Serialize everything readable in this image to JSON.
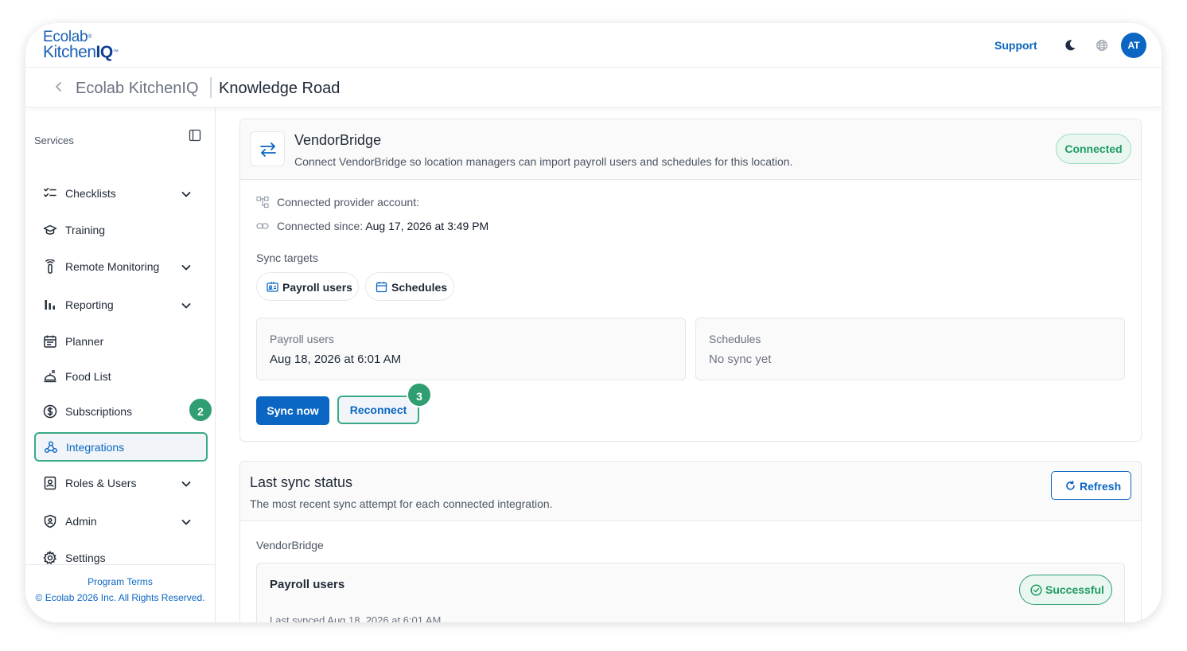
{
  "header": {
    "logo_line1": "Ecolab",
    "logo_line2_a": "Kitchen",
    "logo_line2_b": "IQ",
    "support_label": "Support",
    "avatar_initials": "AT"
  },
  "breadcrumb": {
    "parent": "Ecolab KitchenIQ",
    "current": "Knowledge Road"
  },
  "sidebar": {
    "title": "Services",
    "items": [
      {
        "label": "Checklists",
        "icon": "checklist-icon",
        "has_chevron": true
      },
      {
        "label": "Training",
        "icon": "graduation-cap-icon",
        "has_chevron": false
      },
      {
        "label": "Remote Monitoring",
        "icon": "thermometer-icon",
        "has_chevron": true
      },
      {
        "label": "Reporting",
        "icon": "bar-chart-icon",
        "has_chevron": true
      },
      {
        "label": "Planner",
        "icon": "calendar-icon",
        "has_chevron": false
      },
      {
        "label": "Food List",
        "icon": "food-icon",
        "has_chevron": false
      },
      {
        "label": "Subscriptions",
        "icon": "dollar-icon",
        "has_chevron": false
      },
      {
        "label": "Integrations",
        "icon": "webhook-icon",
        "has_chevron": false,
        "active": true
      },
      {
        "label": "Roles & Users",
        "icon": "id-badge-icon",
        "has_chevron": true
      },
      {
        "label": "Admin",
        "icon": "shield-icon",
        "has_chevron": true
      },
      {
        "label": "Settings",
        "icon": "gear-icon",
        "has_chevron": false
      }
    ],
    "footer_terms": "Program Terms",
    "footer_copyright": "© Ecolab 2026 Inc. All Rights Reserved."
  },
  "step_badges": {
    "integrations": "2",
    "reconnect": "3"
  },
  "vendor_card": {
    "title": "VendorBridge",
    "subtitle": "Connect VendorBridge so location managers can import payroll users and schedules for this location.",
    "status": "Connected",
    "account_label": "Connected provider account:",
    "since_label": "Connected since:",
    "since_value": "Aug 17, 2026 at 3:49 PM",
    "sync_targets_label": "Sync targets",
    "targets": [
      "Payroll users",
      "Schedules"
    ],
    "stats": [
      {
        "label": "Payroll users",
        "value": "Aug 18, 2026 at 6:01 AM"
      },
      {
        "label": "Schedules",
        "value": "No sync yet"
      }
    ],
    "sync_now_label": "Sync now",
    "reconnect_label": "Reconnect"
  },
  "last_sync": {
    "title": "Last sync status",
    "subtitle": "The most recent sync attempt for each connected integration.",
    "refresh_label": "Refresh",
    "group": "VendorBridge",
    "row_name": "Payroll users",
    "row_status": "Successful",
    "row_last": "Last synced Aug 18, 2026 at 6:01 AM"
  },
  "colors": {
    "primary": "#0a66c2",
    "success": "#1f9a63",
    "badge": "#2f9e72"
  }
}
